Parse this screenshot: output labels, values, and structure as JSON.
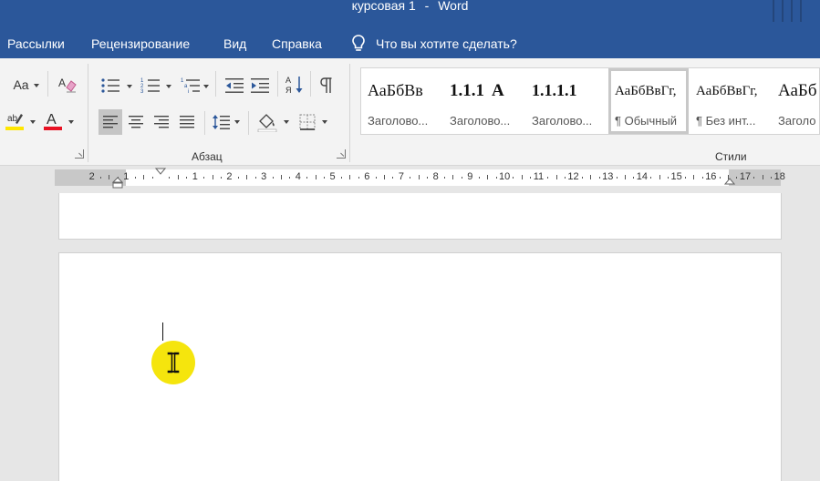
{
  "titlebar": {
    "doc_name": "курсовая 1",
    "separator": "-",
    "app_name": "Word"
  },
  "menu": {
    "items": [
      "Рассылки",
      "Рецензирование",
      "Вид",
      "Справка"
    ],
    "tell_me": "Что вы хотите сделать?"
  },
  "ribbon": {
    "font_group": {
      "change_case_label": "Aa"
    },
    "paragraph_label": "Абзац",
    "styles_label": "Стили",
    "styles": [
      {
        "sample": "АаБбВв",
        "name": "Заголово..."
      },
      {
        "sample": "1.1.1",
        "name": "Заголово..."
      },
      {
        "sample": "1.1.1.1",
        "name": "Заголово..."
      },
      {
        "sample": "АаБбВвГг,",
        "name": "¶ Обычный"
      },
      {
        "sample": "АаБбВвГг,",
        "name": "¶ Без инт..."
      },
      {
        "sample": "АаБб",
        "name": "Заголо"
      }
    ],
    "colors": {
      "highlight": "#ffe600",
      "font_color": "#e81123",
      "accent": "#2b579a"
    }
  },
  "ruler": {
    "left_labels": [
      "2",
      "1"
    ],
    "right_labels": [
      "1",
      "2",
      "3",
      "4",
      "5",
      "6",
      "7",
      "8",
      "9",
      "10",
      "11",
      "12",
      "13",
      "14",
      "15",
      "16",
      "17",
      "18"
    ]
  },
  "document": {
    "cursor_icon": "text-i-beam-icon"
  }
}
